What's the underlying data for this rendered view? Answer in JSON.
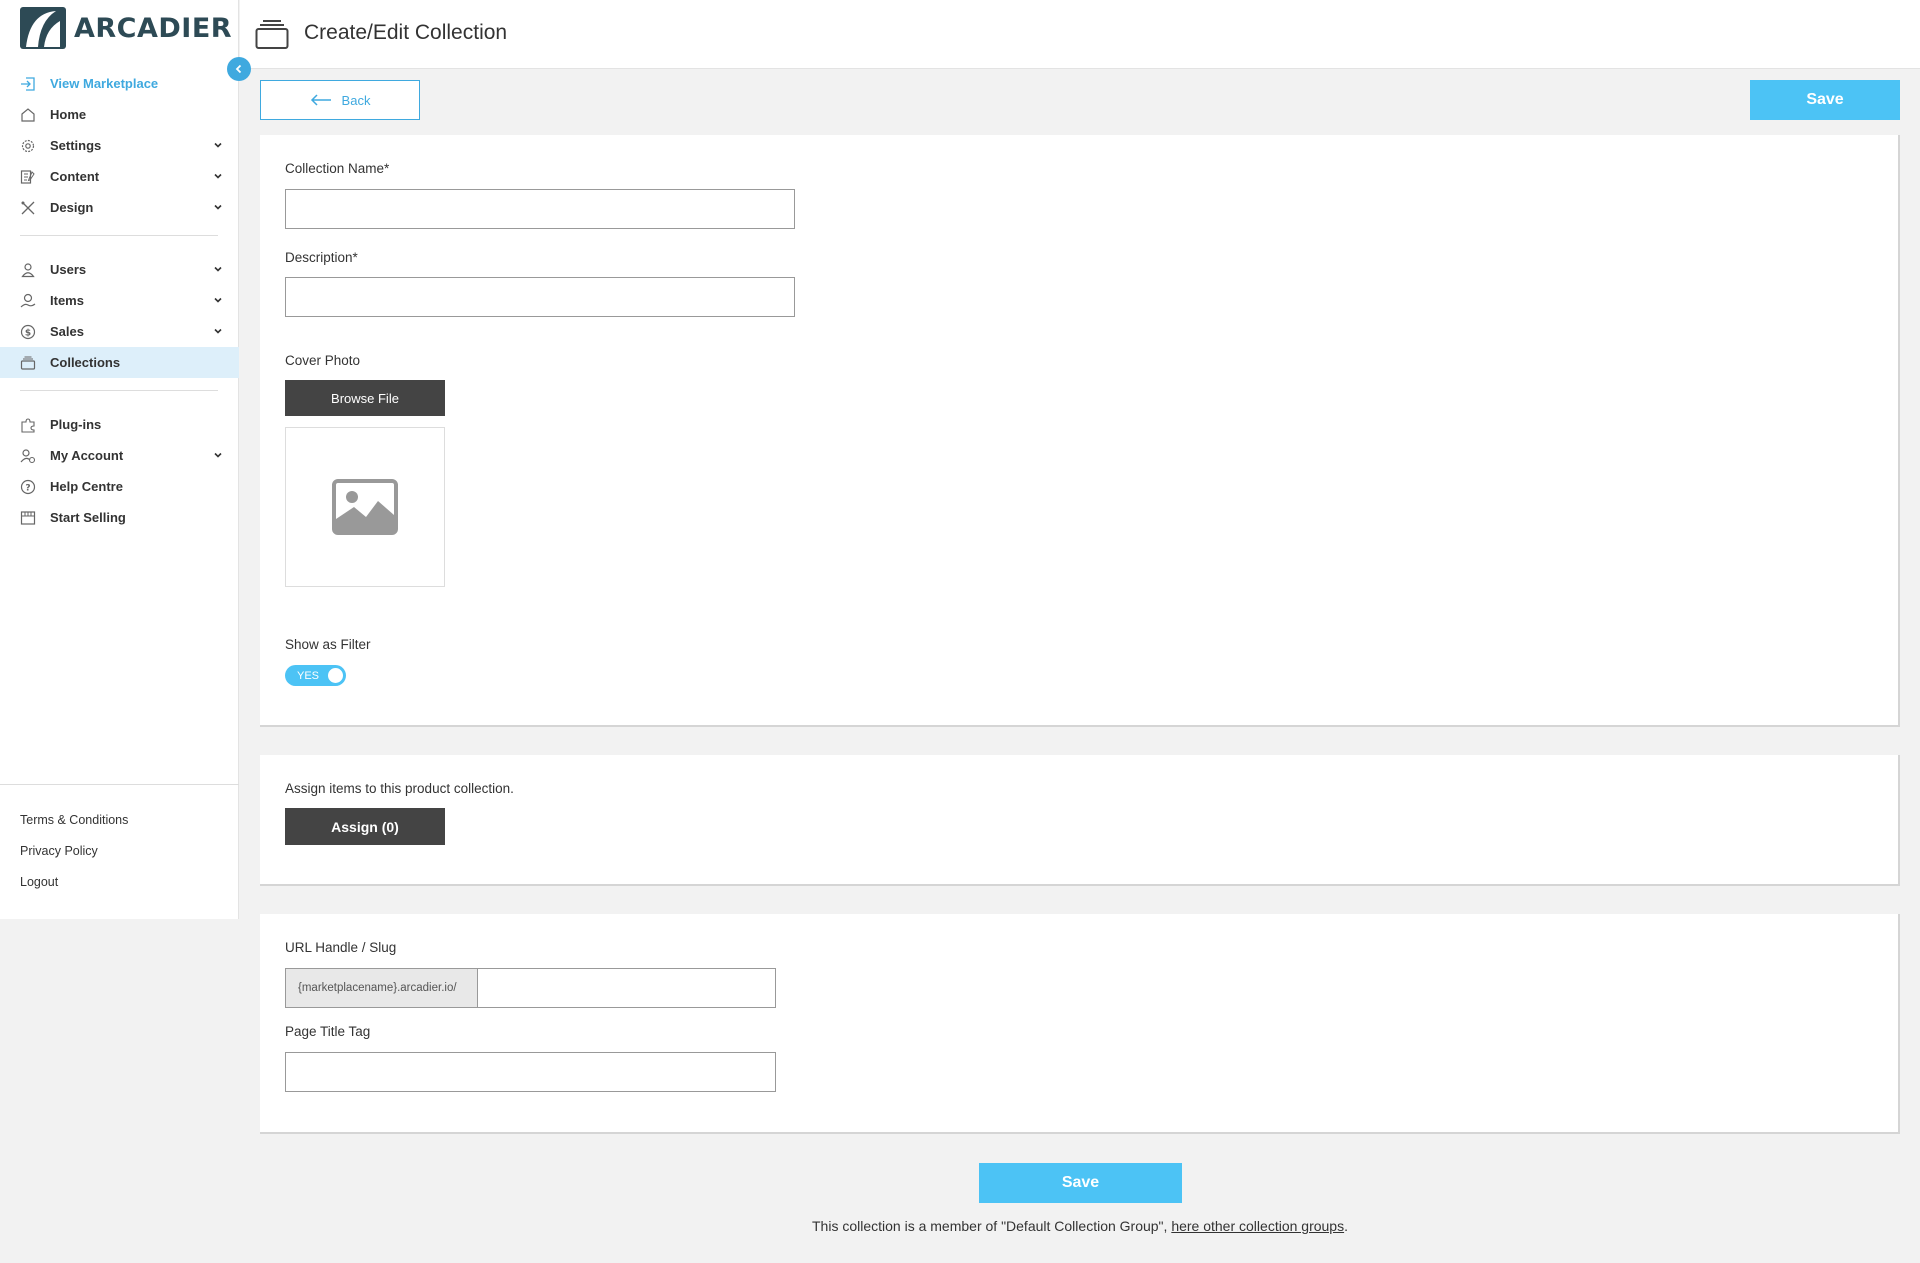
{
  "brand": {
    "name": "ARCADIER",
    "color": "#2d4a55",
    "accent": "#3fa9df",
    "button_blue": "#4cc3f5"
  },
  "sidebar": {
    "items": [
      {
        "label": "View Marketplace",
        "icon": "enter-icon"
      },
      {
        "label": "Home",
        "icon": "home-icon"
      },
      {
        "label": "Settings",
        "icon": "gear-icon"
      },
      {
        "label": "Content",
        "icon": "content-icon"
      },
      {
        "label": "Design",
        "icon": "design-icon"
      },
      {
        "label": "Users",
        "icon": "user-icon"
      },
      {
        "label": "Items",
        "icon": "items-icon"
      },
      {
        "label": "Sales",
        "icon": "dollar-icon"
      },
      {
        "label": "Collections",
        "icon": "collections-icon"
      },
      {
        "label": "Plug-ins",
        "icon": "puzzle-icon"
      },
      {
        "label": "My Account",
        "icon": "account-icon"
      },
      {
        "label": "Help Centre",
        "icon": "help-icon"
      },
      {
        "label": "Start Selling",
        "icon": "store-icon"
      }
    ],
    "footer": [
      "Terms & Conditions",
      "Privacy Policy",
      "Logout"
    ]
  },
  "header": {
    "title": "Create/Edit Collection"
  },
  "actions": {
    "back_label": "Back",
    "save_label": "Save"
  },
  "form": {
    "collection_name_label": "Collection Name*",
    "collection_name_value": "",
    "description_label": "Description*",
    "description_value": "",
    "cover_photo_label": "Cover Photo",
    "browse_label": "Browse File",
    "show_filter_label": "Show as Filter",
    "show_filter_value": "YES"
  },
  "assign": {
    "text": "Assign items to this product collection.",
    "button_label": "Assign (0)"
  },
  "seo": {
    "url_label": "URL Handle / Slug",
    "url_prefix": "{marketplacename}.arcadier.io/",
    "url_value": "",
    "page_title_label": "Page Title Tag",
    "page_title_value": ""
  },
  "footer_note": {
    "prefix": "This collection is a member of \"Default Collection Group\", ",
    "link": "here other collection groups",
    "suffix": "."
  }
}
